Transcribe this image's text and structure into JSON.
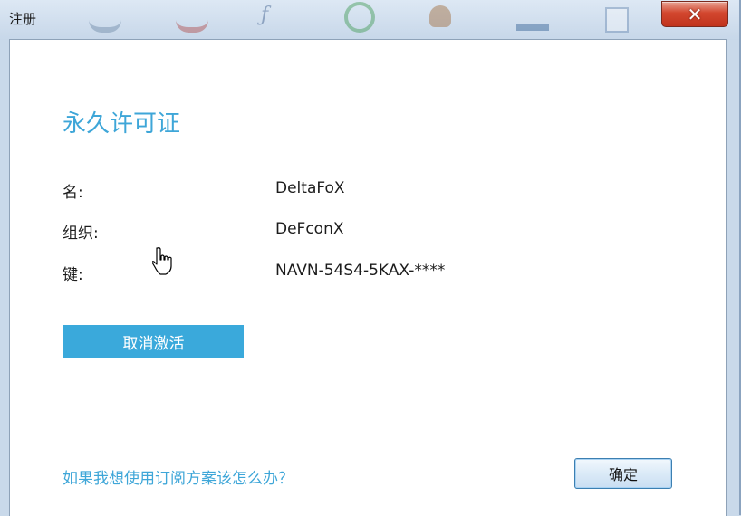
{
  "window": {
    "title": "注册",
    "close_icon": "close-icon"
  },
  "dialog": {
    "heading": "永久许可证",
    "fields": [
      {
        "label": "名:",
        "value": "DeltaFoX"
      },
      {
        "label": "组织:",
        "value": "DeFconX"
      },
      {
        "label": "键:",
        "value": "NAVN-54S4-5KAX-****"
      }
    ],
    "deactivate_label": "取消激活",
    "help_link": "如果我想使用订阅方案该怎么办？",
    "ok_label": "确定"
  },
  "colors": {
    "accent": "#3aa9db",
    "close_red": "#c83a22"
  }
}
